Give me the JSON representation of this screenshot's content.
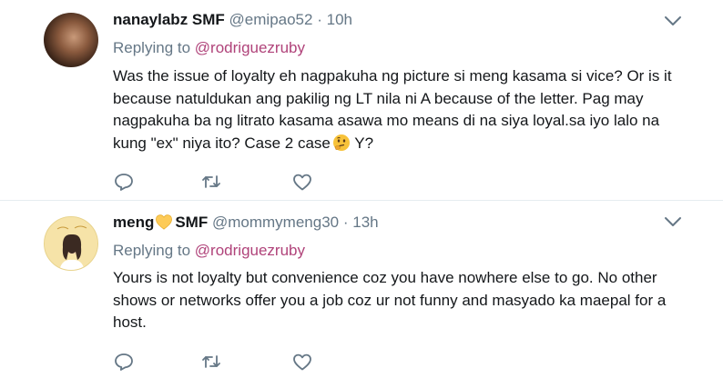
{
  "tweets": [
    {
      "display_name": "nanaylabz SMF",
      "handle": "@emipao52",
      "separator": "·",
      "time": "10h",
      "replying_prefix": "Replying to",
      "replying_to": "@rodriguezruby",
      "text_part1": "Was the issue of loyalty eh nagpakuha ng picture si meng kasama si vice? Or is it\nbecause  natuldukan ang pakilig ng LT nila ni A because of the letter.  Pag may\nnagpakuha ba ng litrato kasama asawa mo means di na siya loyal.sa iyo lalo na\nkung \"ex\" niya ito?  Case 2 case",
      "text_part2": "   Y?"
    },
    {
      "display_name_part1": "meng",
      "display_name_part2": "SMF",
      "handle": "@mommymeng30",
      "separator": "·",
      "time": "13h",
      "replying_prefix": "Replying to",
      "replying_to": "@rodriguezruby",
      "text": "Yours is not loyalty but convenience coz you have nowhere else to go. No other\nshows or networks offer you a job coz ur not funny and masyado ka maepal for a\nhost."
    }
  ],
  "icons": {
    "menu": "chevron-down-icon",
    "reply": "reply-icon",
    "retweet": "retweet-icon",
    "like": "heart-icon",
    "emoji_heart": "yellow-heart-emoji",
    "emoji_thinking": "thinking-face-emoji"
  },
  "colors": {
    "link": "#b0437a",
    "secondary_text": "#657786",
    "divider": "#e6ecf0"
  }
}
